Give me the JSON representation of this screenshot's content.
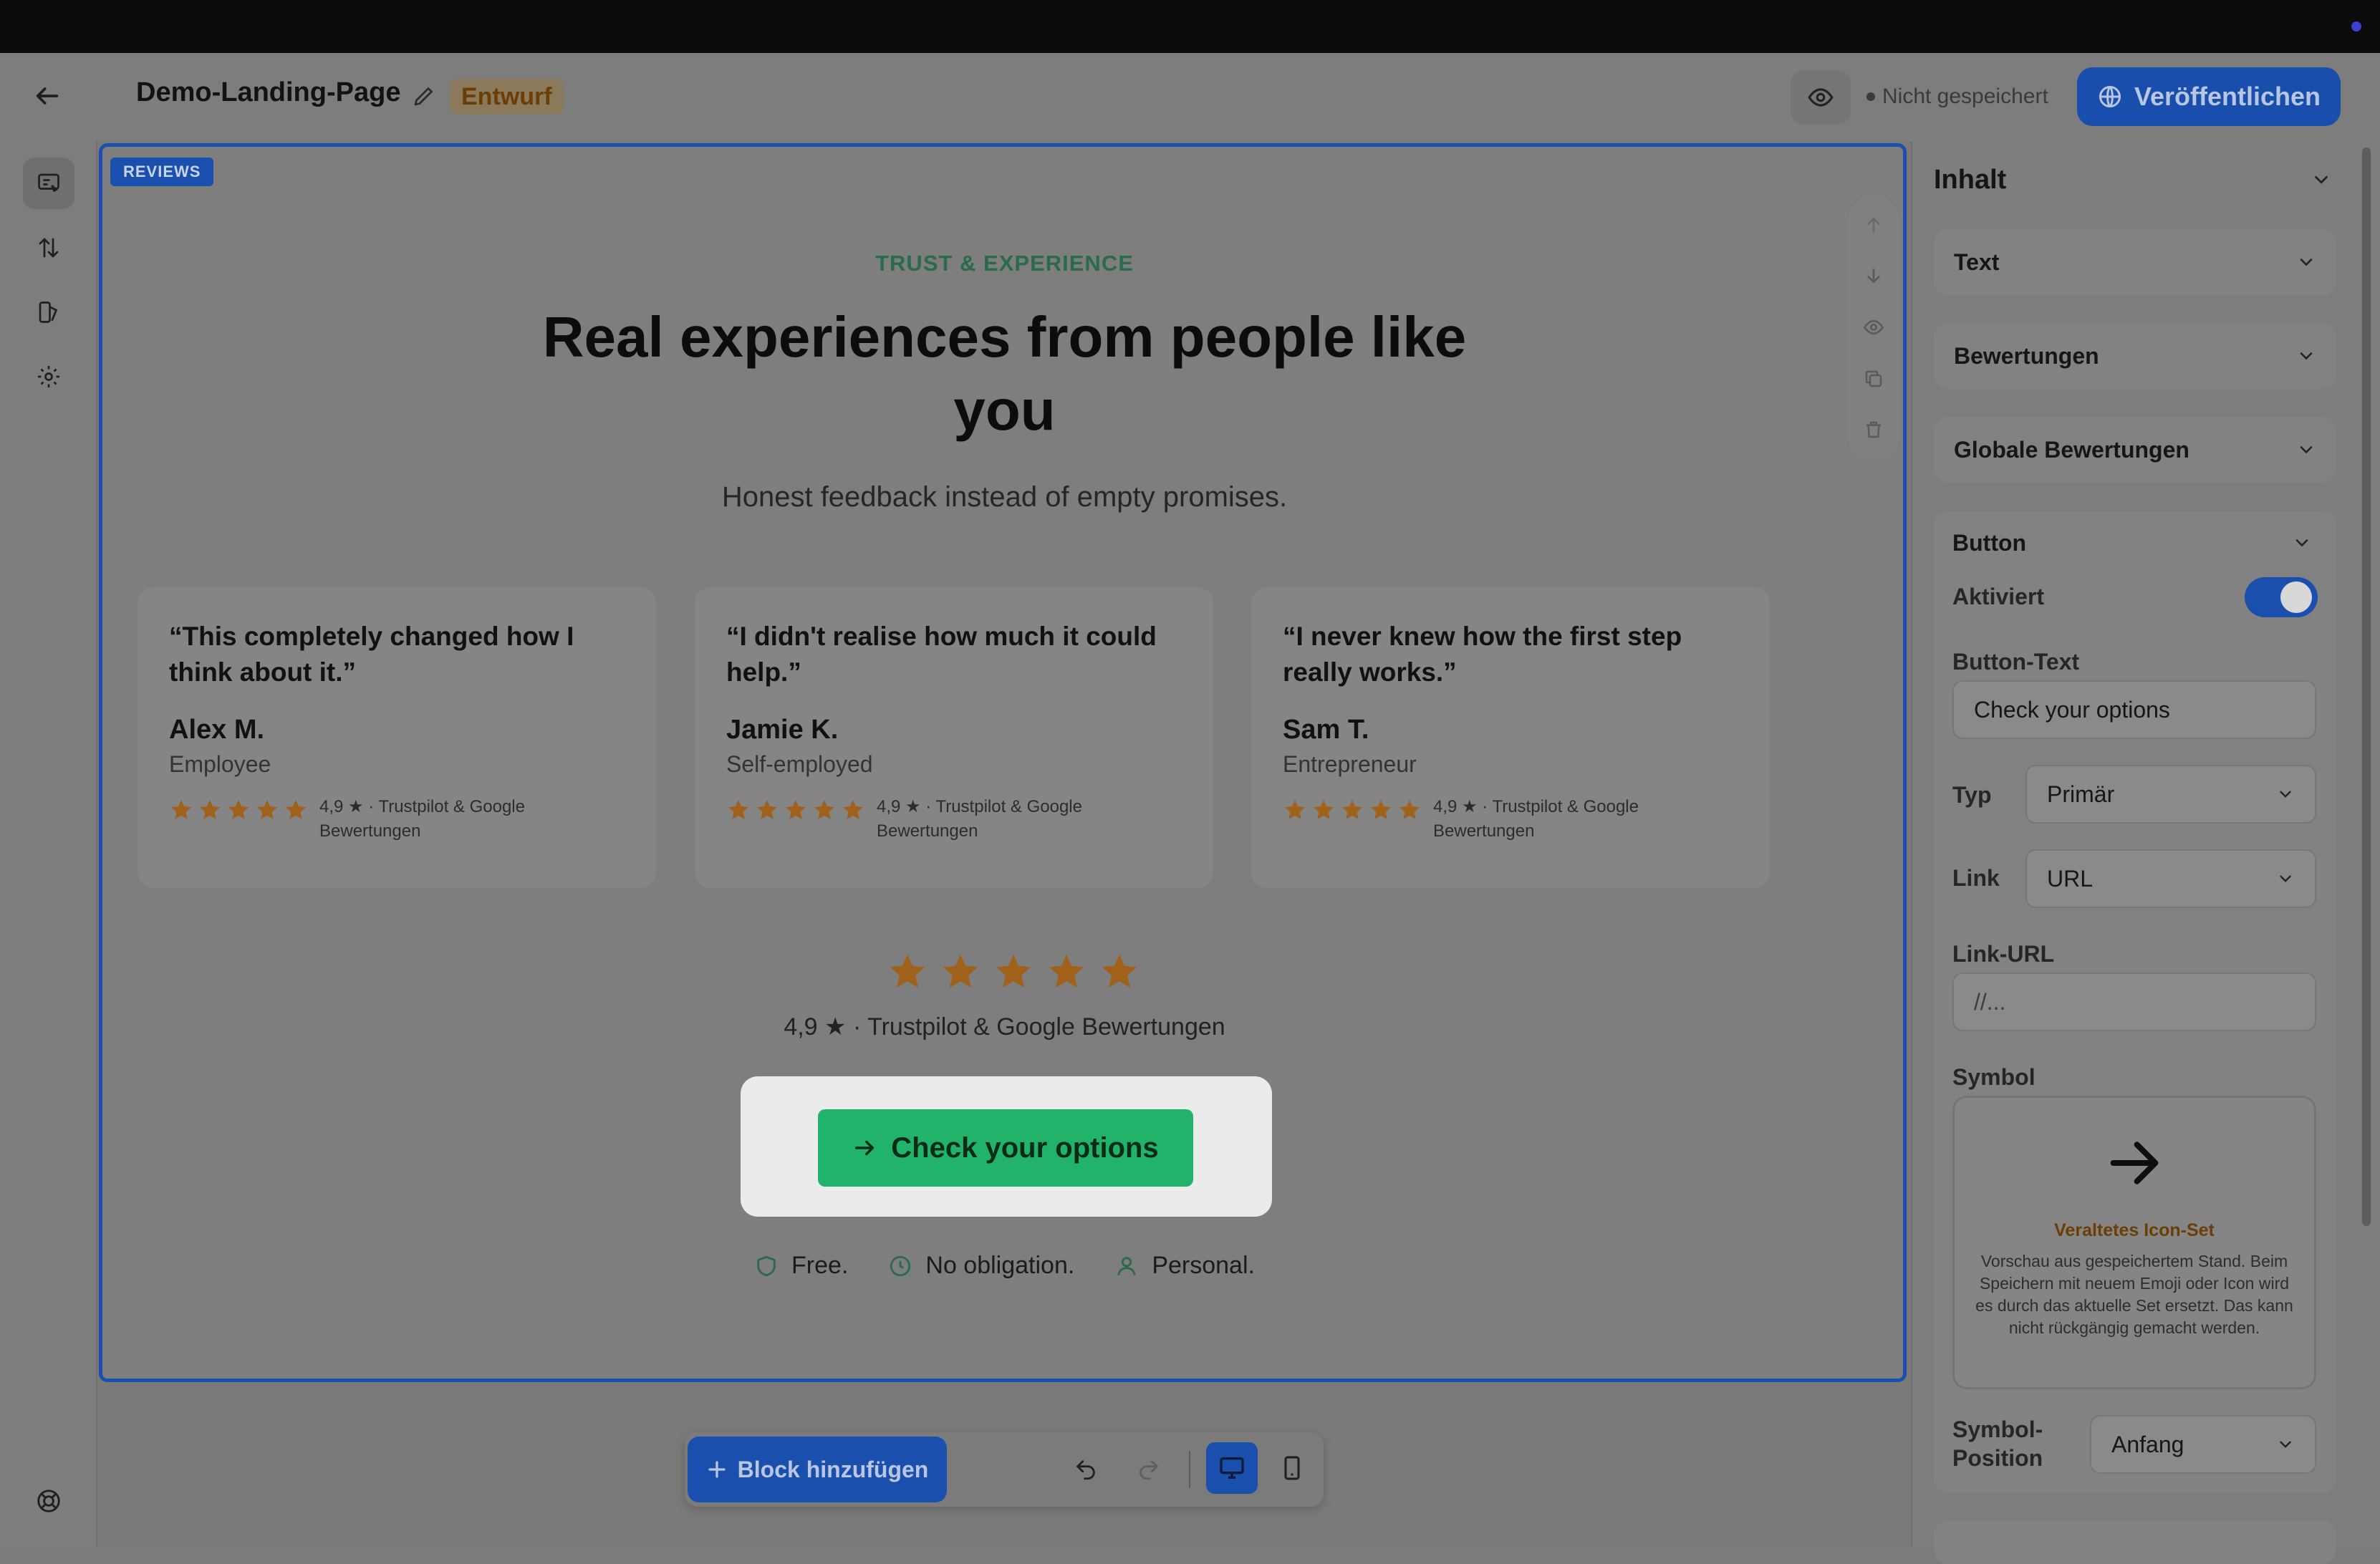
{
  "header": {
    "page_title": "Demo-Landing-Page",
    "draft_badge": "Entwurf",
    "save_status": "Nicht gespeichert",
    "publish_label": "Veröffentlichen"
  },
  "section": {
    "tag": "REVIEWS",
    "eyebrow": "TRUST & EXPERIENCE",
    "headline": "Real experiences from people like you",
    "subheadline": "Honest feedback instead of empty promises.",
    "cards": [
      {
        "quote": "“This completely changed how I think about it.”",
        "name": "Alex M.",
        "role": "Employee",
        "rating_text": "4,9 ★ · Trustpilot & Google Bewertungen",
        "stars": 5
      },
      {
        "quote": "“I didn't realise how much it could help.”",
        "name": "Jamie K.",
        "role": "Self-employed",
        "rating_text": "4,9 ★ · Trustpilot & Google Bewertungen",
        "stars": 5
      },
      {
        "quote": "“I never knew how the first step really works.”",
        "name": "Sam T.",
        "role": "Entrepreneur",
        "rating_text": "4,9 ★ · Trustpilot & Google Bewertungen",
        "stars": 5
      }
    ],
    "aggregate_stars": 5,
    "aggregate_text": "4,9 ★ · Trustpilot & Google Bewertungen",
    "cta_label": "Check your options",
    "trust": [
      {
        "icon": "shield-icon",
        "label": "Free."
      },
      {
        "icon": "clock-icon",
        "label": "No obligation."
      },
      {
        "icon": "person-icon",
        "label": "Personal."
      }
    ]
  },
  "toolbar": {
    "add_block_label": "Block hinzufügen"
  },
  "panel": {
    "title": "Inhalt",
    "accordions": [
      "Text",
      "Bewertungen",
      "Globale Bewertungen"
    ],
    "button_section": {
      "title": "Button",
      "enabled_label": "Aktiviert",
      "enabled": true,
      "button_text_label": "Button-Text",
      "button_text_value": "Check your options",
      "type_label": "Typ",
      "type_value": "Primär",
      "link_label": "Link",
      "link_value": "URL",
      "link_url_label": "Link-URL",
      "link_url_placeholder": "//...",
      "symbol_label": "Symbol",
      "legacy_title": "Veraltetes Icon-Set",
      "legacy_desc": "Vorschau aus gespeichertem Stand. Beim Speichern mit neuem Emoji oder Icon wird es durch das aktuelle Set ersetzt. Das kann nicht rückgängig gemacht werden.",
      "symbol_position_label": "Symbol-Position",
      "symbol_position_value": "Anfang"
    }
  },
  "colors": {
    "accent": "#1b4fae",
    "cta": "#22b36a",
    "star": "#a0611a",
    "eyebrow": "#2a6b4a"
  }
}
